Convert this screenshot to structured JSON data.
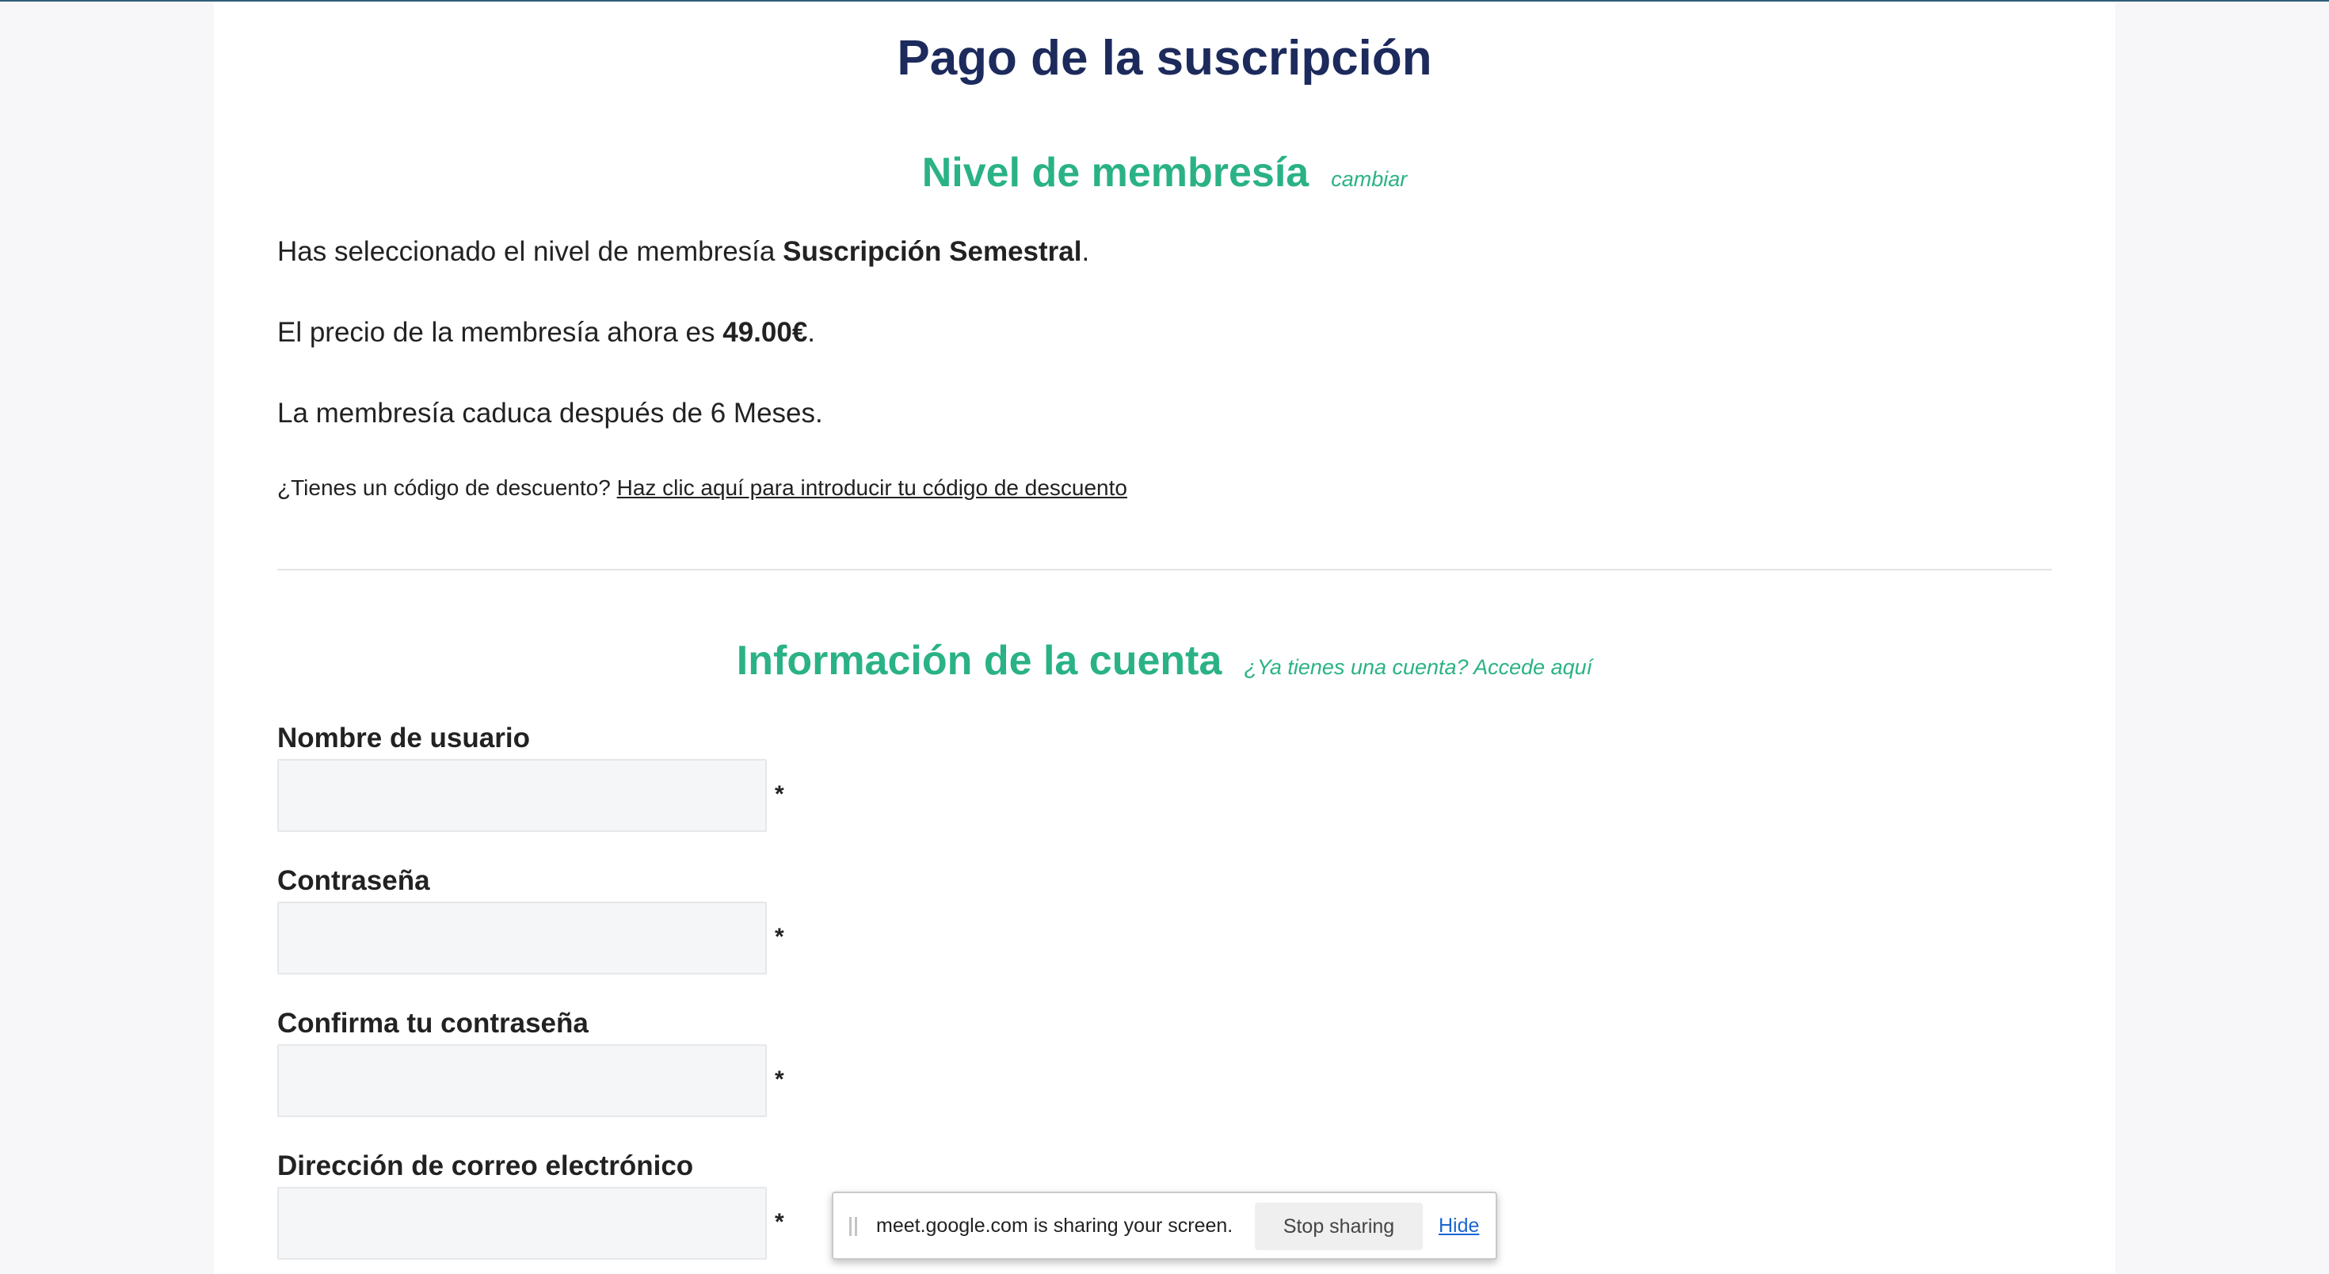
{
  "page_title": "Pago de la suscripción",
  "membership": {
    "heading": "Nivel de membresía",
    "change_link": "cambiar",
    "selected_prefix": "Has seleccionado el nivel de membresía ",
    "selected_level": "Suscripción Semestral",
    "selected_suffix": ".",
    "price_prefix": "El precio de la membresía ahora es ",
    "price_value": "49.00€",
    "price_suffix": ".",
    "expiry_text": "La membresía caduca después de 6 Meses.",
    "discount_question": "¿Tienes un código de descuento? ",
    "discount_link": "Haz clic aquí para introducir tu código de descuento"
  },
  "account": {
    "heading": "Información de la cuenta",
    "login_link": "¿Ya tienes una cuenta? Accede aquí",
    "required_marker": "*",
    "fields": [
      {
        "label": "Nombre de usuario",
        "value": ""
      },
      {
        "label": "Contraseña",
        "value": ""
      },
      {
        "label": "Confirma tu contraseña",
        "value": ""
      },
      {
        "label": "Dirección de correo electrónico",
        "value": ""
      }
    ]
  },
  "share_bar": {
    "message": "meet.google.com is sharing your screen.",
    "stop_label": "Stop sharing",
    "hide_label": "Hide"
  },
  "colors": {
    "title": "#1c2a5c",
    "accent_green": "#2ab286",
    "link_blue": "#1a66d2"
  }
}
